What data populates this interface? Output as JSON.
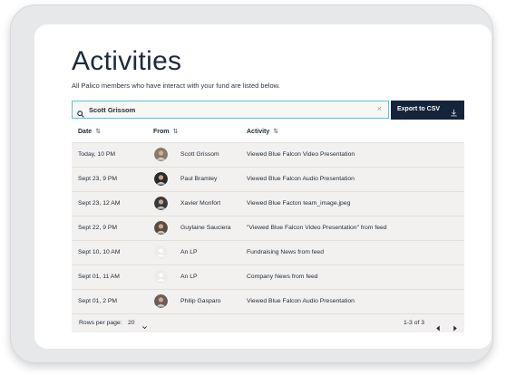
{
  "page": {
    "title": "Activities",
    "subtitle": "All Palico members who have interact with your fund are listed below."
  },
  "search": {
    "value": "Scott Grissom",
    "clear_symbol": "×"
  },
  "toolbar": {
    "export_label": "Export to CSV"
  },
  "table": {
    "columns": [
      {
        "label": "Date",
        "sort_symbol": "⇅"
      },
      {
        "label": "From",
        "sort_symbol": "⇅"
      },
      {
        "label": "Activity",
        "sort_symbol": "⇅"
      }
    ],
    "rows": [
      {
        "date": "Today, 10 PM",
        "from": "Scott Grissom",
        "activity": "Viewed Blue Falcon Video Presentation",
        "avatar": "photo",
        "avatar_color": "#8a7a68"
      },
      {
        "date": "Sept 23, 9 PM",
        "from": "Paul Bramley",
        "activity": "Viewed Blue Falcon Audio Presentation",
        "avatar": "photo",
        "avatar_color": "#2b2a28"
      },
      {
        "date": "Sept 23, 12 AM",
        "from": "Xavier Monfort",
        "activity": "Viewed Blue Facton team_image.jpeg",
        "avatar": "photo",
        "avatar_color": "#3a3938"
      },
      {
        "date": "Sept 22,  9 PM",
        "from": "Guylaine Sauciera",
        "activity": "\"Viewed Blue Falcon Video Presentation\" from feed",
        "avatar": "photo",
        "avatar_color": "#5b4a3e"
      },
      {
        "date": "Sept 10,  10 AM",
        "from": "An LP",
        "activity": "Fundraising News from feed",
        "avatar": "placeholder",
        "avatar_color": "#ececea"
      },
      {
        "date": "Sept 01,  11 AM",
        "from": "An LP",
        "activity": "Company News from feed",
        "avatar": "placeholder",
        "avatar_color": "#ececea"
      },
      {
        "date": "Sept 01,  2 PM",
        "from": "Philip Gasparo",
        "activity": "Viewed Blue Falcon Audio Presentation",
        "avatar": "photo",
        "avatar_color": "#6d5c58"
      }
    ]
  },
  "pagination": {
    "rows_per_page_label": "Rows per page:",
    "rows_per_page_value": "20",
    "range_text": "1-3 of 3"
  },
  "icons": {
    "search": "search-icon",
    "clear": "close-icon",
    "download": "download-icon",
    "sort": "sort-icon",
    "chevron": "chevron-down-icon",
    "prev": "chevron-left-icon",
    "next": "chevron-right-icon"
  },
  "colors": {
    "accent_border": "#58c5d4",
    "button_bg": "#14243a",
    "table_bg": "#f2f1ef"
  }
}
